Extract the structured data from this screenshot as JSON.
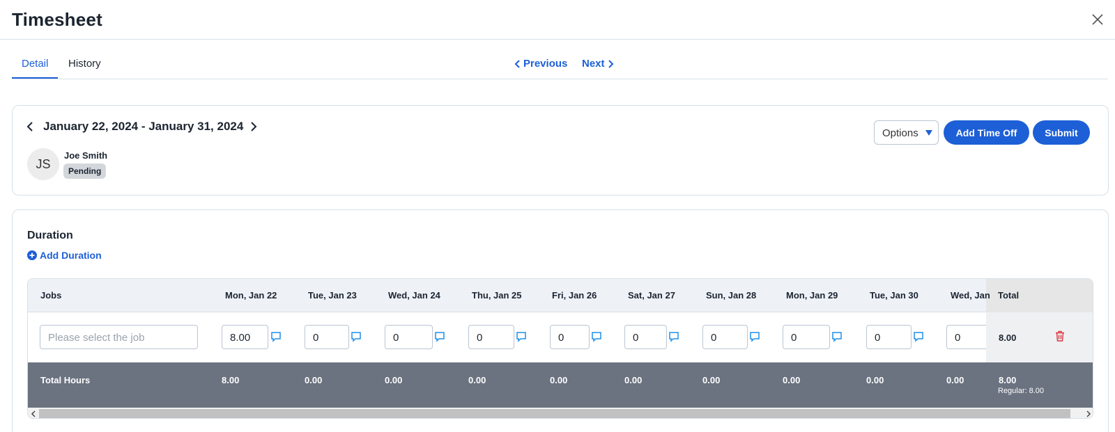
{
  "header": {
    "title": "Timesheet"
  },
  "tabs": [
    {
      "label": "Detail",
      "active": true
    },
    {
      "label": "History",
      "active": false
    }
  ],
  "pager": {
    "previous_label": "Previous",
    "next_label": "Next"
  },
  "period": {
    "label": "January 22, 2024 - January 31, 2024"
  },
  "employee": {
    "initials": "JS",
    "name": "Joe Smith",
    "status": "Pending"
  },
  "actions": {
    "options_label": "Options",
    "add_time_off_label": "Add Time Off",
    "submit_label": "Submit"
  },
  "duration": {
    "title": "Duration",
    "add_label": "Add Duration",
    "table": {
      "jobs_header": "Jobs",
      "days": [
        "Mon, Jan 22",
        "Tue, Jan 23",
        "Wed, Jan 24",
        "Thu, Jan 25",
        "Fri, Jan 26",
        "Sat, Jan 27",
        "Sun, Jan 28",
        "Mon, Jan 29",
        "Tue, Jan 30",
        "Wed, Jan"
      ],
      "total_header": "Total",
      "row": {
        "job_placeholder": "Please select the job",
        "hours": [
          "8.00",
          "0",
          "0",
          "0",
          "0",
          "0",
          "0",
          "0",
          "0",
          "0"
        ],
        "total": "8.00"
      },
      "footer": {
        "label": "Total Hours",
        "hours": [
          "8.00",
          "0.00",
          "0.00",
          "0.00",
          "0.00",
          "0.00",
          "0.00",
          "0.00",
          "0.00",
          "0.00"
        ],
        "total": "8.00",
        "regular": "Regular: 8.00"
      }
    }
  },
  "colors": {
    "accent": "#1d5fd6",
    "footer_bg": "#6b7280",
    "delete": "#d9363e"
  }
}
